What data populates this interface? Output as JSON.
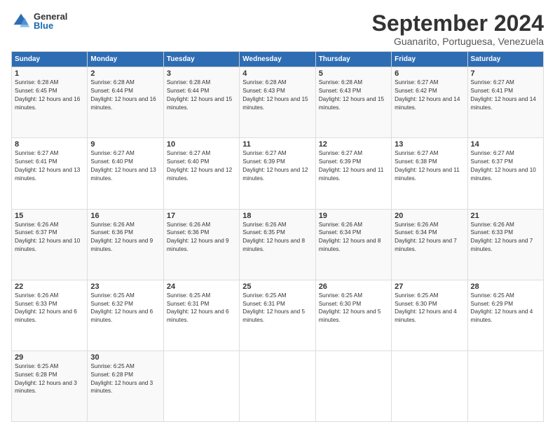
{
  "logo": {
    "general": "General",
    "blue": "Blue"
  },
  "header": {
    "month": "September 2024",
    "location": "Guanarito, Portuguesa, Venezuela"
  },
  "weekdays": [
    "Sunday",
    "Monday",
    "Tuesday",
    "Wednesday",
    "Thursday",
    "Friday",
    "Saturday"
  ],
  "weeks": [
    [
      {
        "day": "1",
        "sunrise": "6:28 AM",
        "sunset": "6:45 PM",
        "daylight": "12 hours and 16 minutes."
      },
      {
        "day": "2",
        "sunrise": "6:28 AM",
        "sunset": "6:44 PM",
        "daylight": "12 hours and 16 minutes."
      },
      {
        "day": "3",
        "sunrise": "6:28 AM",
        "sunset": "6:44 PM",
        "daylight": "12 hours and 15 minutes."
      },
      {
        "day": "4",
        "sunrise": "6:28 AM",
        "sunset": "6:43 PM",
        "daylight": "12 hours and 15 minutes."
      },
      {
        "day": "5",
        "sunrise": "6:28 AM",
        "sunset": "6:43 PM",
        "daylight": "12 hours and 15 minutes."
      },
      {
        "day": "6",
        "sunrise": "6:27 AM",
        "sunset": "6:42 PM",
        "daylight": "12 hours and 14 minutes."
      },
      {
        "day": "7",
        "sunrise": "6:27 AM",
        "sunset": "6:41 PM",
        "daylight": "12 hours and 14 minutes."
      }
    ],
    [
      {
        "day": "8",
        "sunrise": "6:27 AM",
        "sunset": "6:41 PM",
        "daylight": "12 hours and 13 minutes."
      },
      {
        "day": "9",
        "sunrise": "6:27 AM",
        "sunset": "6:40 PM",
        "daylight": "12 hours and 13 minutes."
      },
      {
        "day": "10",
        "sunrise": "6:27 AM",
        "sunset": "6:40 PM",
        "daylight": "12 hours and 12 minutes."
      },
      {
        "day": "11",
        "sunrise": "6:27 AM",
        "sunset": "6:39 PM",
        "daylight": "12 hours and 12 minutes."
      },
      {
        "day": "12",
        "sunrise": "6:27 AM",
        "sunset": "6:39 PM",
        "daylight": "12 hours and 11 minutes."
      },
      {
        "day": "13",
        "sunrise": "6:27 AM",
        "sunset": "6:38 PM",
        "daylight": "12 hours and 11 minutes."
      },
      {
        "day": "14",
        "sunrise": "6:27 AM",
        "sunset": "6:37 PM",
        "daylight": "12 hours and 10 minutes."
      }
    ],
    [
      {
        "day": "15",
        "sunrise": "6:26 AM",
        "sunset": "6:37 PM",
        "daylight": "12 hours and 10 minutes."
      },
      {
        "day": "16",
        "sunrise": "6:26 AM",
        "sunset": "6:36 PM",
        "daylight": "12 hours and 9 minutes."
      },
      {
        "day": "17",
        "sunrise": "6:26 AM",
        "sunset": "6:36 PM",
        "daylight": "12 hours and 9 minutes."
      },
      {
        "day": "18",
        "sunrise": "6:26 AM",
        "sunset": "6:35 PM",
        "daylight": "12 hours and 8 minutes."
      },
      {
        "day": "19",
        "sunrise": "6:26 AM",
        "sunset": "6:34 PM",
        "daylight": "12 hours and 8 minutes."
      },
      {
        "day": "20",
        "sunrise": "6:26 AM",
        "sunset": "6:34 PM",
        "daylight": "12 hours and 7 minutes."
      },
      {
        "day": "21",
        "sunrise": "6:26 AM",
        "sunset": "6:33 PM",
        "daylight": "12 hours and 7 minutes."
      }
    ],
    [
      {
        "day": "22",
        "sunrise": "6:26 AM",
        "sunset": "6:33 PM",
        "daylight": "12 hours and 6 minutes."
      },
      {
        "day": "23",
        "sunrise": "6:25 AM",
        "sunset": "6:32 PM",
        "daylight": "12 hours and 6 minutes."
      },
      {
        "day": "24",
        "sunrise": "6:25 AM",
        "sunset": "6:31 PM",
        "daylight": "12 hours and 6 minutes."
      },
      {
        "day": "25",
        "sunrise": "6:25 AM",
        "sunset": "6:31 PM",
        "daylight": "12 hours and 5 minutes."
      },
      {
        "day": "26",
        "sunrise": "6:25 AM",
        "sunset": "6:30 PM",
        "daylight": "12 hours and 5 minutes."
      },
      {
        "day": "27",
        "sunrise": "6:25 AM",
        "sunset": "6:30 PM",
        "daylight": "12 hours and 4 minutes."
      },
      {
        "day": "28",
        "sunrise": "6:25 AM",
        "sunset": "6:29 PM",
        "daylight": "12 hours and 4 minutes."
      }
    ],
    [
      {
        "day": "29",
        "sunrise": "6:25 AM",
        "sunset": "6:28 PM",
        "daylight": "12 hours and 3 minutes."
      },
      {
        "day": "30",
        "sunrise": "6:25 AM",
        "sunset": "6:28 PM",
        "daylight": "12 hours and 3 minutes."
      },
      null,
      null,
      null,
      null,
      null
    ]
  ]
}
